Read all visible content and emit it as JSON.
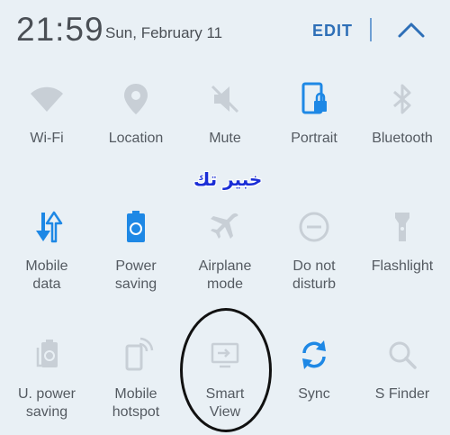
{
  "header": {
    "time": "21:59",
    "date": "Sun, February 11",
    "edit_label": "EDIT"
  },
  "watermark": "خبير تك",
  "tiles": [
    {
      "label": "Wi-Fi",
      "icon": "wifi-icon",
      "active": false
    },
    {
      "label": "Location",
      "icon": "location-pin-icon",
      "active": false
    },
    {
      "label": "Mute",
      "icon": "mute-icon",
      "active": false
    },
    {
      "label": "Portrait",
      "icon": "portrait-lock-icon",
      "active": true
    },
    {
      "label": "Bluetooth",
      "icon": "bluetooth-icon",
      "active": false
    },
    {
      "label": "Mobile\ndata",
      "icon": "mobile-data-icon",
      "active": true
    },
    {
      "label": "Power\nsaving",
      "icon": "power-saving-icon",
      "active": true
    },
    {
      "label": "Airplane\nmode",
      "icon": "airplane-icon",
      "active": false
    },
    {
      "label": "Do not\ndisturb",
      "icon": "do-not-disturb-icon",
      "active": false
    },
    {
      "label": "Flashlight",
      "icon": "flashlight-icon",
      "active": false
    },
    {
      "label": "U. power\nsaving",
      "icon": "ultra-power-saving-icon",
      "active": false
    },
    {
      "label": "Mobile\nhotspot",
      "icon": "hotspot-icon",
      "active": false
    },
    {
      "label": "Smart\nView",
      "icon": "smart-view-icon",
      "active": false
    },
    {
      "label": "Sync",
      "icon": "sync-icon",
      "active": true
    },
    {
      "label": "S Finder",
      "icon": "search-icon",
      "active": false
    }
  ],
  "colors": {
    "accent": "#1e88e5",
    "inactive_icon": "#c5ccd3",
    "text": "#545a61",
    "background": "#e9f0f5"
  }
}
